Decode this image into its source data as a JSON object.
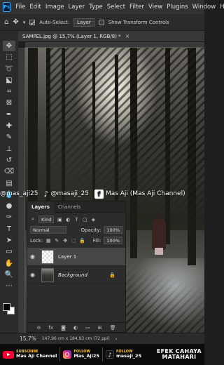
{
  "menubar": {
    "logo": "Ps",
    "items": [
      "File",
      "Edit",
      "Image",
      "Layer",
      "Type",
      "Select",
      "Filter",
      "View",
      "Plugins",
      "Window",
      "Help"
    ]
  },
  "options": {
    "auto_select_label": "Auto-Select:",
    "auto_select_value": "Layer",
    "transform_label": "Show Transform Controls"
  },
  "document": {
    "tab_title": "SAMPEL.jpg @ 15,7% (Layer 1, RGB/8) *",
    "close_glyph": "×"
  },
  "social": {
    "instagram": "@mas_aji25",
    "tiktok": "@masaji_25",
    "facebook": "Mas Aji (Mas Aji Channel)"
  },
  "layers_panel": {
    "tabs": [
      "Layers",
      "Channels"
    ],
    "filter_value": "Kind",
    "blend_mode": "Normal",
    "opacity_label": "Opacity:",
    "opacity_value": "100%",
    "lock_label": "Lock:",
    "fill_label": "Fill:",
    "fill_value": "100%",
    "layers": [
      {
        "name": "Layer 1",
        "selected": true
      },
      {
        "name": "Background",
        "selected": false
      }
    ],
    "bottom_icons": [
      "link-icon",
      "fx-icon",
      "mask-icon",
      "adjustment-icon",
      "group-icon",
      "new-layer-icon",
      "trash-icon"
    ],
    "fx_label": "fx"
  },
  "status": {
    "zoom": "15,7%",
    "doc_info": "147,96 cm x 184,93 cm (72 ppi)",
    "arrow": "›"
  },
  "footer": {
    "youtube_small": "SUBSCRIBE",
    "youtube_big": "Mas Aji Channel",
    "instagram_small": "FOLLOW",
    "instagram_big": "Mas_Aji25",
    "tiktok_small": "FOLLOW",
    "tiktok_big": "masaji_25",
    "title_line1": "EFEK CAHAYA",
    "title_line2": "MATAHARI"
  },
  "colors": {
    "ps_blue": "#31a8ff",
    "youtube_red": "#ff0033",
    "footer_yellow": "#ffcc33"
  }
}
